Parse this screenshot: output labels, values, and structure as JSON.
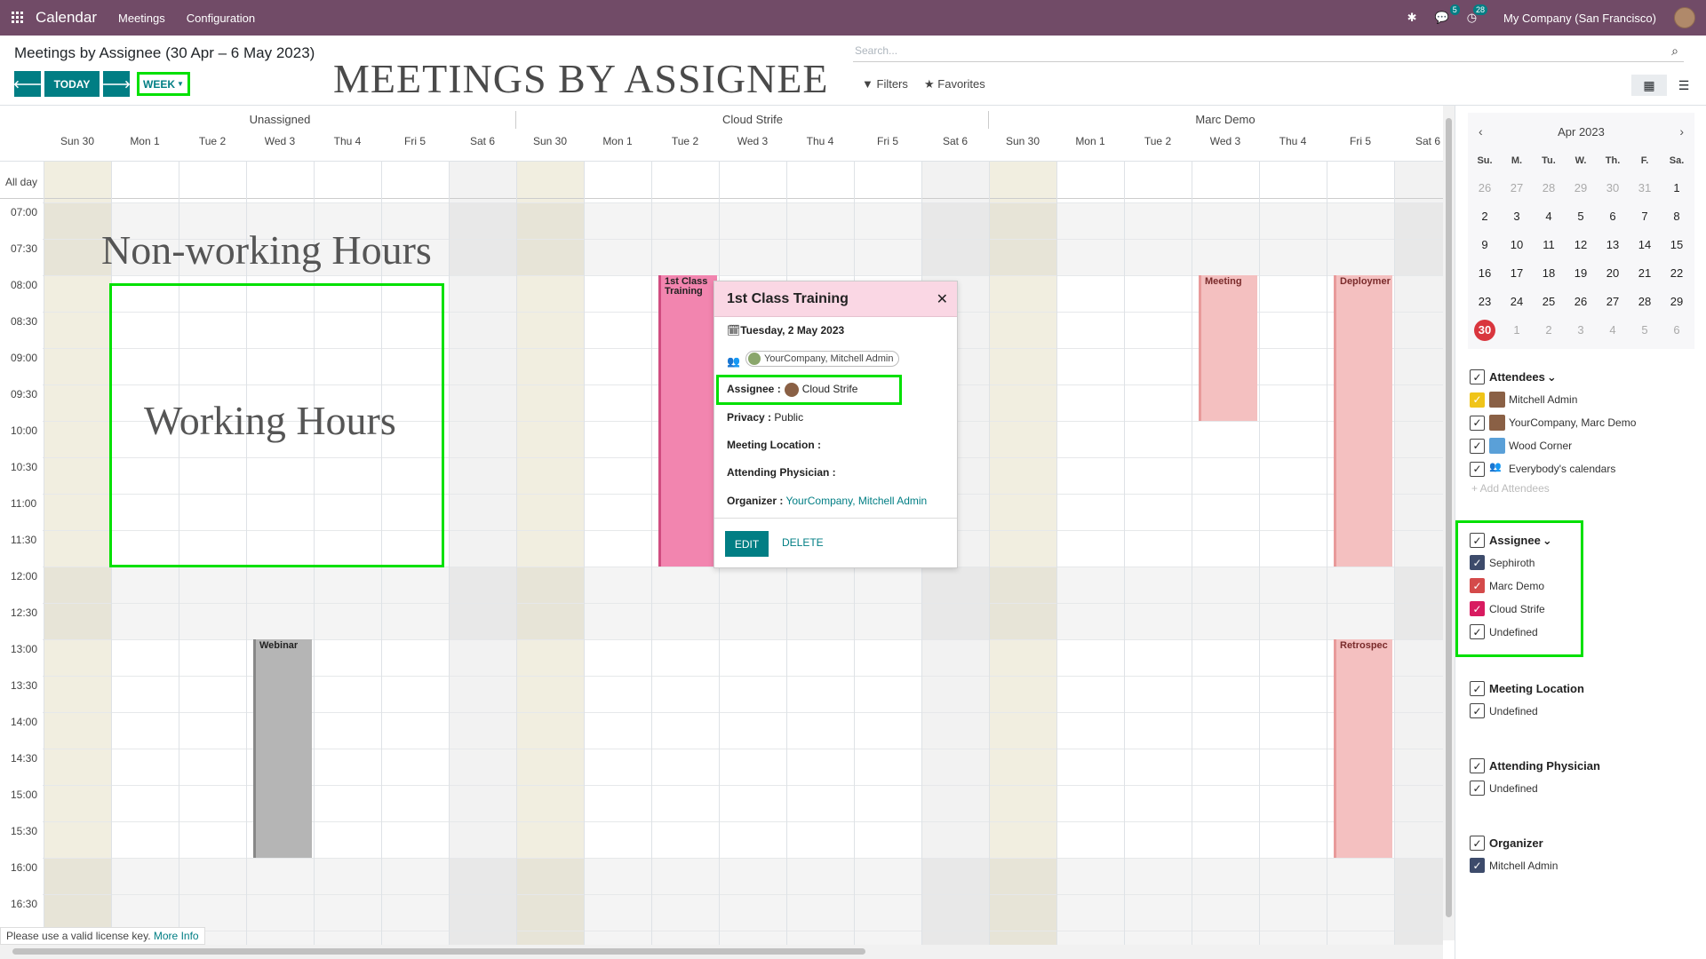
{
  "navbar": {
    "app_title": "Calendar",
    "menu": [
      "Meetings",
      "Configuration"
    ],
    "chat_badge": "5",
    "activity_badge": "28",
    "company": "My Company (San Francisco)"
  },
  "control_panel": {
    "breadcrumb": "Meetings by Assignee (30 Apr – 6 May 2023)",
    "today_label": "TODAY",
    "scale_label": "WEEK",
    "search_placeholder": "Search...",
    "filters_label": "Filters",
    "favorites_label": "Favorites"
  },
  "annotations": {
    "title_overlay": "MEETINGS BY ASSIGNEE",
    "non_working": "Non-working Hours",
    "working": "Working Hours"
  },
  "calendar": {
    "groups": [
      "Unassigned",
      "Cloud Strife",
      "Marc Demo"
    ],
    "days": [
      "Sun 30",
      "Mon 1",
      "Tue 2",
      "Wed 3",
      "Thu 4",
      "Fri 5",
      "Sat 6"
    ],
    "allday_label": "All day",
    "times": [
      "07:00",
      "07:30",
      "08:00",
      "08:30",
      "09:00",
      "09:30",
      "10:00",
      "10:30",
      "11:00",
      "11:30",
      "12:00",
      "12:30",
      "13:00",
      "13:30",
      "14:00",
      "14:30",
      "15:00",
      "15:30",
      "16:00",
      "16:30"
    ],
    "events": {
      "training": "1st Class Training",
      "meeting": "Meeting",
      "deployment": "Deploymer",
      "webinar": "Webinar",
      "retro": "Retrospec"
    }
  },
  "popover": {
    "title": "1st Class Training",
    "date": "Tuesday, 2 May 2023",
    "attendees": "YourCompany, Mitchell Admin",
    "assignee_label": "Assignee :",
    "assignee_value": "Cloud Strife",
    "privacy_label": "Privacy :",
    "privacy_value": "Public",
    "location_label": "Meeting Location :",
    "physician_label": "Attending Physician :",
    "organizer_label": "Organizer :",
    "organizer_value": "YourCompany, Mitchell Admin",
    "edit_label": "EDIT",
    "delete_label": "DELETE"
  },
  "footer": {
    "license_text": "Please use a valid license key.",
    "more_info": "More Info"
  },
  "sidebar": {
    "mini_month": "Apr 2023",
    "dow": [
      "Su.",
      "M.",
      "Tu.",
      "W.",
      "Th.",
      "F.",
      "Sa."
    ],
    "weeks": [
      [
        "26",
        "27",
        "28",
        "29",
        "30",
        "31",
        "1"
      ],
      [
        "2",
        "3",
        "4",
        "5",
        "6",
        "7",
        "8"
      ],
      [
        "9",
        "10",
        "11",
        "12",
        "13",
        "14",
        "15"
      ],
      [
        "16",
        "17",
        "18",
        "19",
        "20",
        "21",
        "22"
      ],
      [
        "23",
        "24",
        "25",
        "26",
        "27",
        "28",
        "29"
      ],
      [
        "30",
        "1",
        "2",
        "3",
        "4",
        "5",
        "6"
      ]
    ],
    "attendees_title": "Attendees",
    "attendees": [
      "Mitchell Admin",
      "YourCompany, Marc Demo",
      "Wood Corner",
      "Everybody's calendars"
    ],
    "add_attendees": "+ Add Attendees",
    "assignee_title": "Assignee",
    "assignees": [
      "Sephiroth",
      "Marc Demo",
      "Cloud Strife",
      "Undefined"
    ],
    "location_title": "Meeting Location",
    "location_items": [
      "Undefined"
    ],
    "physician_title": "Attending Physician",
    "physician_items": [
      "Undefined"
    ],
    "organizer_title": "Organizer",
    "organizer_items": [
      "Mitchell Admin"
    ]
  },
  "colors": {
    "navbar": "#714b67",
    "primary": "#017e84",
    "annotation": "#00e000",
    "training": "#f285af",
    "salmon": "#f4c0c0",
    "webinar": "#b5b5b5"
  }
}
